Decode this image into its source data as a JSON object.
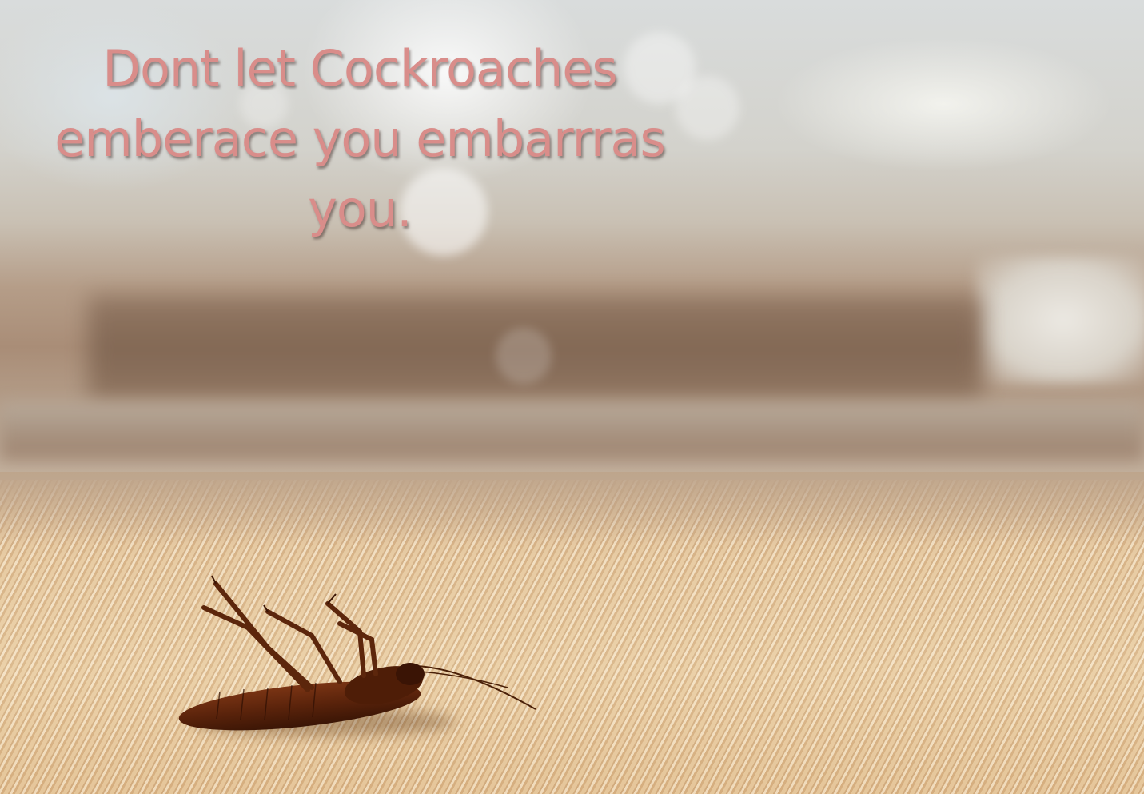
{
  "headline": {
    "text": "Dont let Cockroaches emberace you embarrras you.",
    "color": "#d98d8a"
  },
  "illustration": {
    "subject": "cockroach-icon",
    "setting": "kitchen"
  }
}
